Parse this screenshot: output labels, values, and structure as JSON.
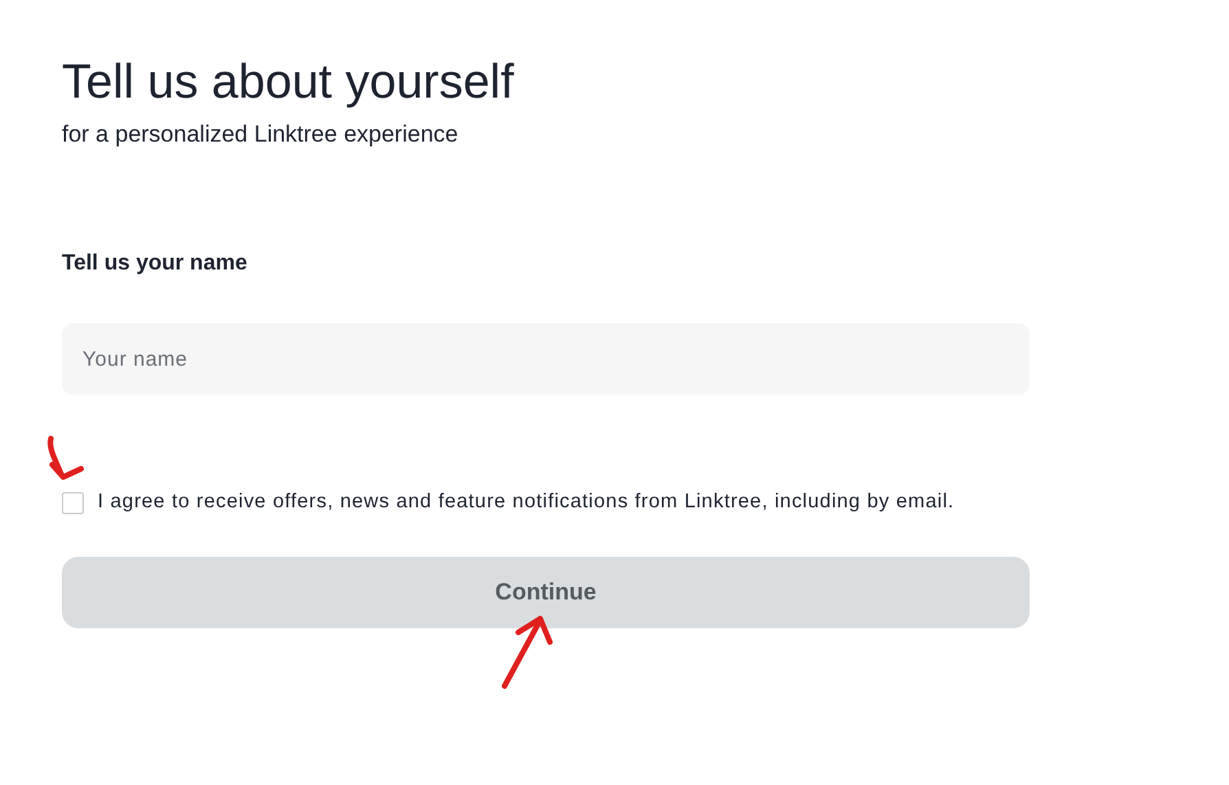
{
  "heading": "Tell us about yourself",
  "subheading": "for a personalized Linktree experience",
  "name_field": {
    "label": "Tell us your name",
    "placeholder": "Your name"
  },
  "consent": {
    "text": "I agree to receive offers, news and feature notifications from Linktree, including by email.",
    "checked": false
  },
  "continue_button": {
    "label": "Continue",
    "disabled": true
  }
}
